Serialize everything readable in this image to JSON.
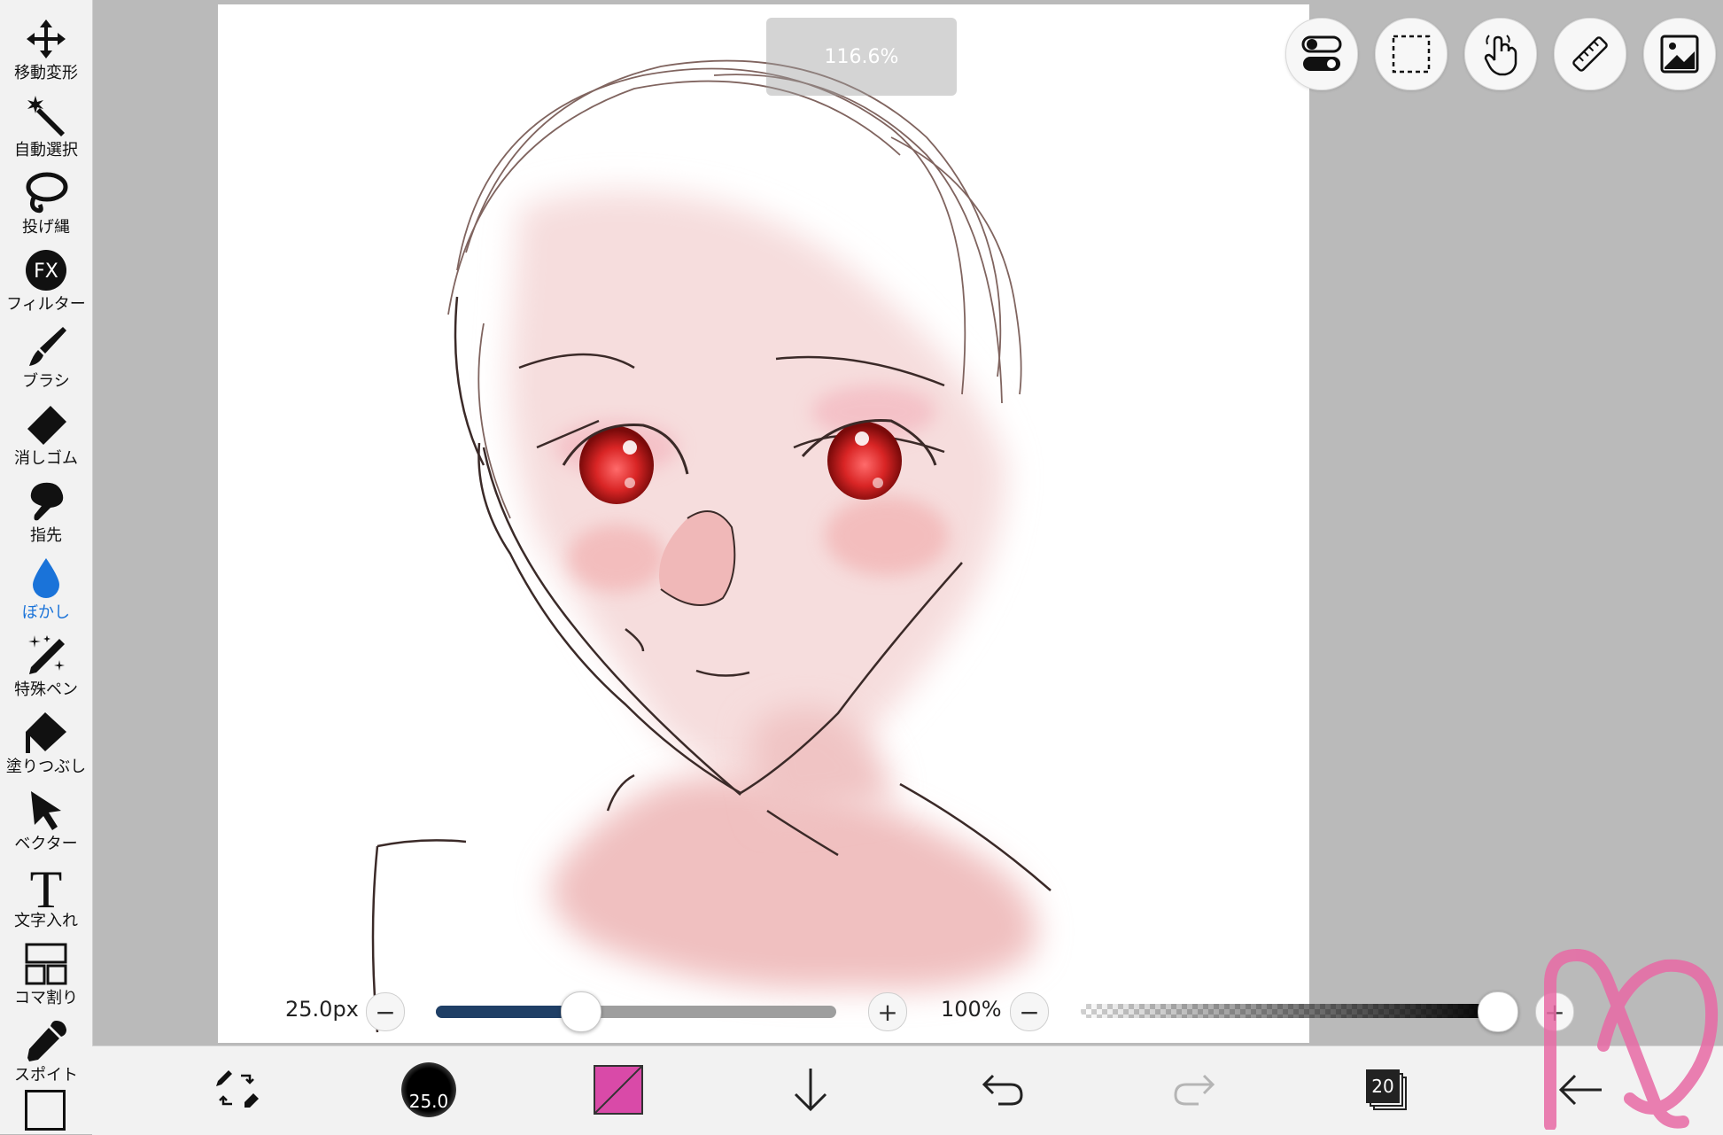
{
  "toolbar": {
    "tools": [
      {
        "label": "移動変形",
        "icon": "move-icon"
      },
      {
        "label": "自動選択",
        "icon": "magic-wand-icon"
      },
      {
        "label": "投げ縄",
        "icon": "lasso-icon"
      },
      {
        "label": "フィルター",
        "icon": "fx-icon"
      },
      {
        "label": "ブラシ",
        "icon": "brush-icon"
      },
      {
        "label": "消しゴム",
        "icon": "eraser-icon"
      },
      {
        "label": "指先",
        "icon": "finger-icon"
      },
      {
        "label": "ぼかし",
        "icon": "blur-drop-icon",
        "active": true
      },
      {
        "label": "特殊ペン",
        "icon": "special-pen-icon"
      },
      {
        "label": "塗りつぶし",
        "icon": "fill-bucket-icon"
      },
      {
        "label": "ベクター",
        "icon": "vector-arrow-icon"
      },
      {
        "label": "文字入れ",
        "icon": "text-icon"
      },
      {
        "label": "コマ割り",
        "icon": "panel-frame-icon"
      },
      {
        "label": "スポイト",
        "icon": "eyedropper-icon"
      }
    ]
  },
  "canvas": {
    "zoom": "116.6%"
  },
  "top_buttons": [
    "toggle-icon",
    "selection-rect-icon",
    "hand-gesture-icon",
    "ruler-icon",
    "image-icon"
  ],
  "brush_size": {
    "value_label": "25.0px",
    "fraction": 0.36
  },
  "opacity": {
    "value_label": "100%",
    "fraction": 1.0
  },
  "bottom_bar": {
    "brush_preview_size": "25.0",
    "color": "#d94aa8",
    "layer_count": "20"
  },
  "colors": {
    "accent": "#1a73d9",
    "slider_fill": "#1f3f66"
  }
}
